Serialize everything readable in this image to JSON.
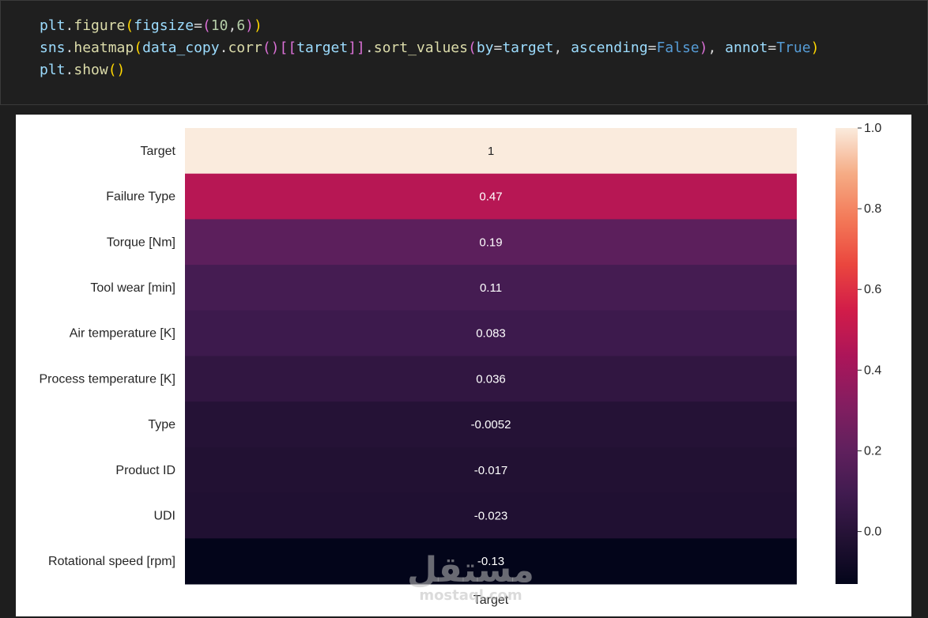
{
  "code": {
    "lines": [
      [
        [
          "plt",
          "tk-var"
        ],
        [
          ".",
          "tk-op"
        ],
        [
          "figure",
          "tk-fn"
        ],
        [
          "(",
          "tk-par1"
        ],
        [
          "figsize",
          "tk-var"
        ],
        [
          "=",
          "tk-op"
        ],
        [
          "(",
          "tk-par2"
        ],
        [
          "10",
          "tk-num"
        ],
        [
          ",",
          "tk-op"
        ],
        [
          "6",
          "tk-num"
        ],
        [
          ")",
          "tk-par2"
        ],
        [
          ")",
          "tk-par1"
        ]
      ],
      [
        [
          "sns",
          "tk-var"
        ],
        [
          ".",
          "tk-op"
        ],
        [
          "heatmap",
          "tk-fn"
        ],
        [
          "(",
          "tk-par1"
        ],
        [
          "data_copy",
          "tk-var"
        ],
        [
          ".",
          "tk-op"
        ],
        [
          "corr",
          "tk-fn"
        ],
        [
          "()",
          "tk-par2"
        ],
        [
          "[[",
          "tk-par2"
        ],
        [
          "target",
          "tk-var"
        ],
        [
          "]]",
          "tk-par2"
        ],
        [
          ".",
          "tk-op"
        ],
        [
          "sort_values",
          "tk-fn"
        ],
        [
          "(",
          "tk-par2"
        ],
        [
          "by",
          "tk-var"
        ],
        [
          "=",
          "tk-op"
        ],
        [
          "target",
          "tk-var"
        ],
        [
          ", ",
          "tk-op"
        ],
        [
          "ascending",
          "tk-var"
        ],
        [
          "=",
          "tk-op"
        ],
        [
          "False",
          "tk-kw"
        ],
        [
          ")",
          "tk-par2"
        ],
        [
          ", ",
          "tk-op"
        ],
        [
          "annot",
          "tk-var"
        ],
        [
          "=",
          "tk-op"
        ],
        [
          "True",
          "tk-kw"
        ],
        [
          ")",
          "tk-par1"
        ]
      ],
      [
        [
          "plt",
          "tk-var"
        ],
        [
          ".",
          "tk-op"
        ],
        [
          "show",
          "tk-fn"
        ],
        [
          "()",
          "tk-par1"
        ]
      ]
    ]
  },
  "chart_data": {
    "type": "heatmap",
    "rows": [
      "Target",
      "Failure Type",
      "Torque [Nm]",
      "Tool wear [min]",
      "Air temperature [K]",
      "Process temperature [K]",
      "Type",
      "Product ID",
      "UDI",
      "Rotational speed [rpm]"
    ],
    "columns": [
      "Target"
    ],
    "values": [
      1,
      0.47,
      0.19,
      0.11,
      0.083,
      0.036,
      -0.0052,
      -0.017,
      -0.023,
      -0.13
    ],
    "annotations": [
      "1",
      "0.47",
      "0.19",
      "0.11",
      "0.083",
      "0.036",
      "-0.0052",
      "-0.017",
      "-0.023",
      "-0.13"
    ],
    "colormap": "rocket",
    "colorbar": {
      "vmin": -0.13,
      "vmax": 1.0,
      "ticks": [
        0.0,
        0.2,
        0.4,
        0.6,
        0.8,
        1.0
      ],
      "tick_labels": [
        "0.0",
        "0.2",
        "0.4",
        "0.6",
        "0.8",
        "1.0"
      ]
    }
  },
  "watermark": {
    "logo": "مستقل",
    "url": "mostaql.com"
  }
}
